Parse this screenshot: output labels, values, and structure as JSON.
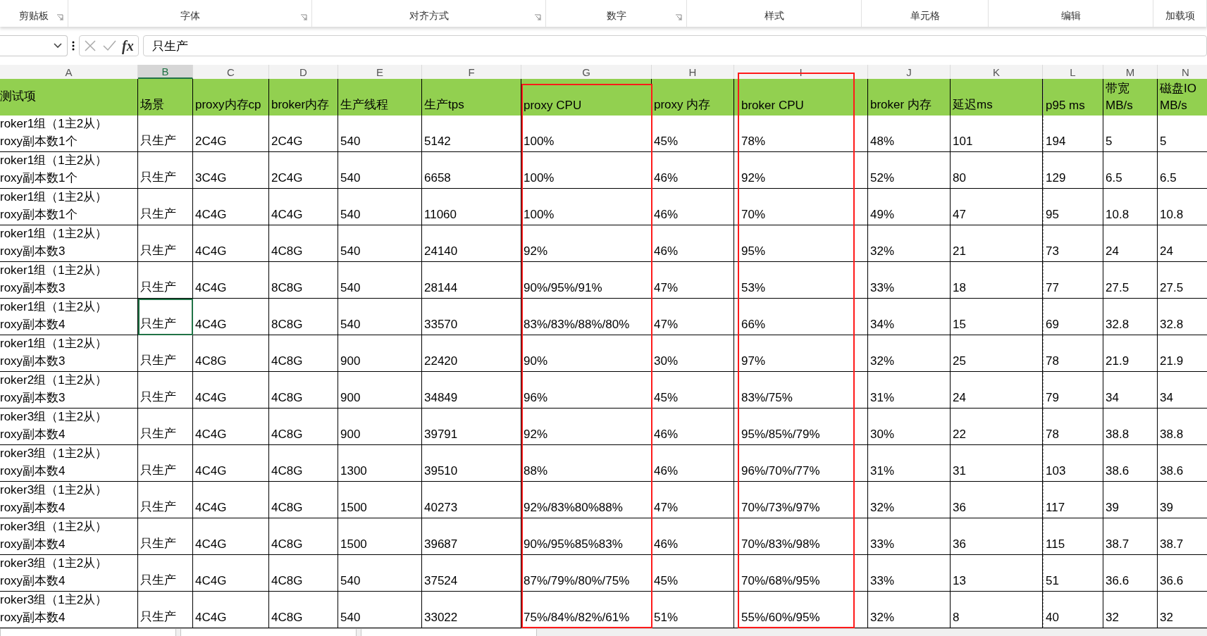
{
  "ribbon_groups": [
    {
      "label": "剪贴板",
      "launcher": true
    },
    {
      "label": "字体",
      "launcher": true
    },
    {
      "label": "对齐方式",
      "launcher": true
    },
    {
      "label": "数字",
      "launcher": true
    },
    {
      "label": "样式",
      "launcher": false
    },
    {
      "label": "单元格",
      "launcher": false
    },
    {
      "label": "编辑",
      "launcher": false
    },
    {
      "label": "加载项",
      "launcher": false
    }
  ],
  "formula_bar": {
    "fx": "fx",
    "value": "只生产"
  },
  "columns": [
    {
      "letter": "A",
      "selected": false
    },
    {
      "letter": "B",
      "selected": true
    },
    {
      "letter": "C",
      "selected": false
    },
    {
      "letter": "D",
      "selected": false
    },
    {
      "letter": "E",
      "selected": false
    },
    {
      "letter": "F",
      "selected": false
    },
    {
      "letter": "G",
      "selected": false
    },
    {
      "letter": "H",
      "selected": false
    },
    {
      "letter": "I",
      "selected": false
    },
    {
      "letter": "J",
      "selected": false
    },
    {
      "letter": "K",
      "selected": false
    },
    {
      "letter": "L",
      "selected": false
    },
    {
      "letter": "M",
      "selected": false
    },
    {
      "letter": "N",
      "selected": false
    }
  ],
  "header": [
    "测试项",
    "场景",
    "proxy内存cp",
    "broker内存",
    "生产线程",
    "生产tps",
    "proxy CPU",
    "proxy 内存",
    "broker CPU",
    "broker 内存",
    "延迟ms",
    "p95 ms",
    [
      "带宽",
      "MB/s"
    ],
    [
      "磁盘IO",
      "MB/s"
    ]
  ],
  "rows": [
    {
      "test_item": [
        "roker1组（1主2从）",
        "roxy副本数1个"
      ],
      "selected": false,
      "values": [
        "只生产",
        "2C4G",
        "2C4G",
        "540",
        "5142",
        "100%",
        "45%",
        "78%",
        "48%",
        "101",
        "194",
        "5",
        "5"
      ]
    },
    {
      "test_item": [
        "roker1组（1主2从）",
        "roxy副本数1个"
      ],
      "selected": false,
      "values": [
        "只生产",
        "3C4G",
        "2C4G",
        "540",
        "6658",
        "100%",
        "46%",
        "92%",
        "52%",
        "80",
        "129",
        "6.5",
        "6.5"
      ]
    },
    {
      "test_item": [
        "roker1组（1主2从）",
        "roxy副本数1个"
      ],
      "selected": false,
      "values": [
        "只生产",
        "4C4G",
        "4C4G",
        "540",
        "11060",
        "100%",
        "46%",
        "70%",
        "49%",
        "47",
        "95",
        "10.8",
        "10.8"
      ]
    },
    {
      "test_item": [
        "roker1组（1主2从）",
        "roxy副本数3"
      ],
      "selected": false,
      "values": [
        "只生产",
        "4C4G",
        "4C8G",
        "540",
        "24140",
        "92%",
        "46%",
        "95%",
        "32%",
        "21",
        "73",
        "24",
        "24"
      ]
    },
    {
      "test_item": [
        "roker1组（1主2从）",
        "roxy副本数3"
      ],
      "selected": false,
      "values": [
        "只生产",
        "4C4G",
        "8C8G",
        "540",
        "28144",
        "90%/95%/91%",
        "47%",
        "53%",
        "33%",
        "18",
        "77",
        "27.5",
        "27.5"
      ]
    },
    {
      "test_item": [
        "roker1组（1主2从）",
        "roxy副本数4"
      ],
      "selected": true,
      "values": [
        "只生产",
        "4C4G",
        "8C8G",
        "540",
        "33570",
        "83%/83%/88%/80%",
        "47%",
        "66%",
        "34%",
        "15",
        "69",
        "32.8",
        "32.8"
      ]
    },
    {
      "test_item": [
        "roker1组（1主2从）",
        "roxy副本数3"
      ],
      "selected": false,
      "values": [
        "只生产",
        "4C8G",
        "4C8G",
        "900",
        "22420",
        "90%",
        "30%",
        "97%",
        "32%",
        "25",
        "78",
        "21.9",
        "21.9"
      ]
    },
    {
      "test_item": [
        "roker2组（1主2从）",
        "roxy副本数3"
      ],
      "selected": false,
      "values": [
        "只生产",
        "4C4G",
        "4C8G",
        "900",
        "34849",
        "96%",
        "45%",
        "83%/75%",
        "31%",
        "24",
        "79",
        "34",
        "34"
      ]
    },
    {
      "test_item": [
        "roker3组（1主2从）",
        "roxy副本数4"
      ],
      "selected": false,
      "values": [
        "只生产",
        "4C4G",
        "4C8G",
        "900",
        "39791",
        "92%",
        "46%",
        "95%/85%/79%",
        "30%",
        "22",
        "78",
        "38.8",
        "38.8"
      ]
    },
    {
      "test_item": [
        "roker3组（1主2从）",
        "roxy副本数4"
      ],
      "selected": false,
      "values": [
        "只生产",
        "4C4G",
        "4C8G",
        "1300",
        "39510",
        "88%",
        "46%",
        "96%/70%/77%",
        "31%",
        "31",
        "103",
        "38.6",
        "38.6"
      ]
    },
    {
      "test_item": [
        "roker3组（1主2从）",
        "roxy副本数4"
      ],
      "selected": false,
      "values": [
        "只生产",
        "4C4G",
        "4C8G",
        "1500",
        "40273",
        "92%/83%80%88%",
        "47%",
        "70%/73%/97%",
        "32%",
        "36",
        "117",
        "39",
        "39"
      ]
    },
    {
      "test_item": [
        "roker3组（1主2从）",
        "roxy副本数4"
      ],
      "selected": false,
      "values": [
        "只生产",
        "4C4G",
        "4C8G",
        "1500",
        "39687",
        "90%/95%85%83%",
        "46%",
        "70%/83%/98%",
        "33%",
        "36",
        "115",
        "38.7",
        "38.7"
      ]
    },
    {
      "test_item": [
        "roker3组（1主2从）",
        "roxy副本数4"
      ],
      "selected": false,
      "values": [
        "只生产",
        "4C4G",
        "4C8G",
        "540",
        "37524",
        "87%/79%/80%/75%",
        "45%",
        "70%/68%/95%",
        "33%",
        "13",
        "51",
        "36.6",
        "36.6"
      ]
    },
    {
      "test_item": [
        "roker3组（1主2从）",
        "roxy副本数4"
      ],
      "selected": false,
      "values": [
        "只生产",
        "4C4G",
        "4C8G",
        "540",
        "33022",
        "75%/84%/82%/61%",
        "51%",
        "55%/60%/95%",
        "32%",
        "8",
        "40",
        "32",
        "32"
      ]
    }
  ]
}
